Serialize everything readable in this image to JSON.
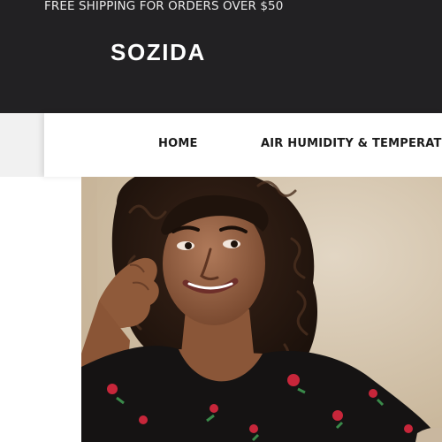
{
  "announcement": {
    "text": "FREE SHIPPING FOR ORDERS OVER $50"
  },
  "header": {
    "logo_text": "SOZIDA"
  },
  "nav": {
    "items": [
      {
        "label": "HOME"
      },
      {
        "label": "AIR HUMIDITY & TEMPERATUR"
      }
    ]
  },
  "colors": {
    "topbar_bg": "#222123",
    "nav_bg": "#ffffff",
    "side_tab_bg": "#f1f1f1",
    "hero_bg": "#d3c3ab"
  },
  "hero": {
    "image_subject": "smiling woman with dark curly hair wearing black floral dress"
  }
}
